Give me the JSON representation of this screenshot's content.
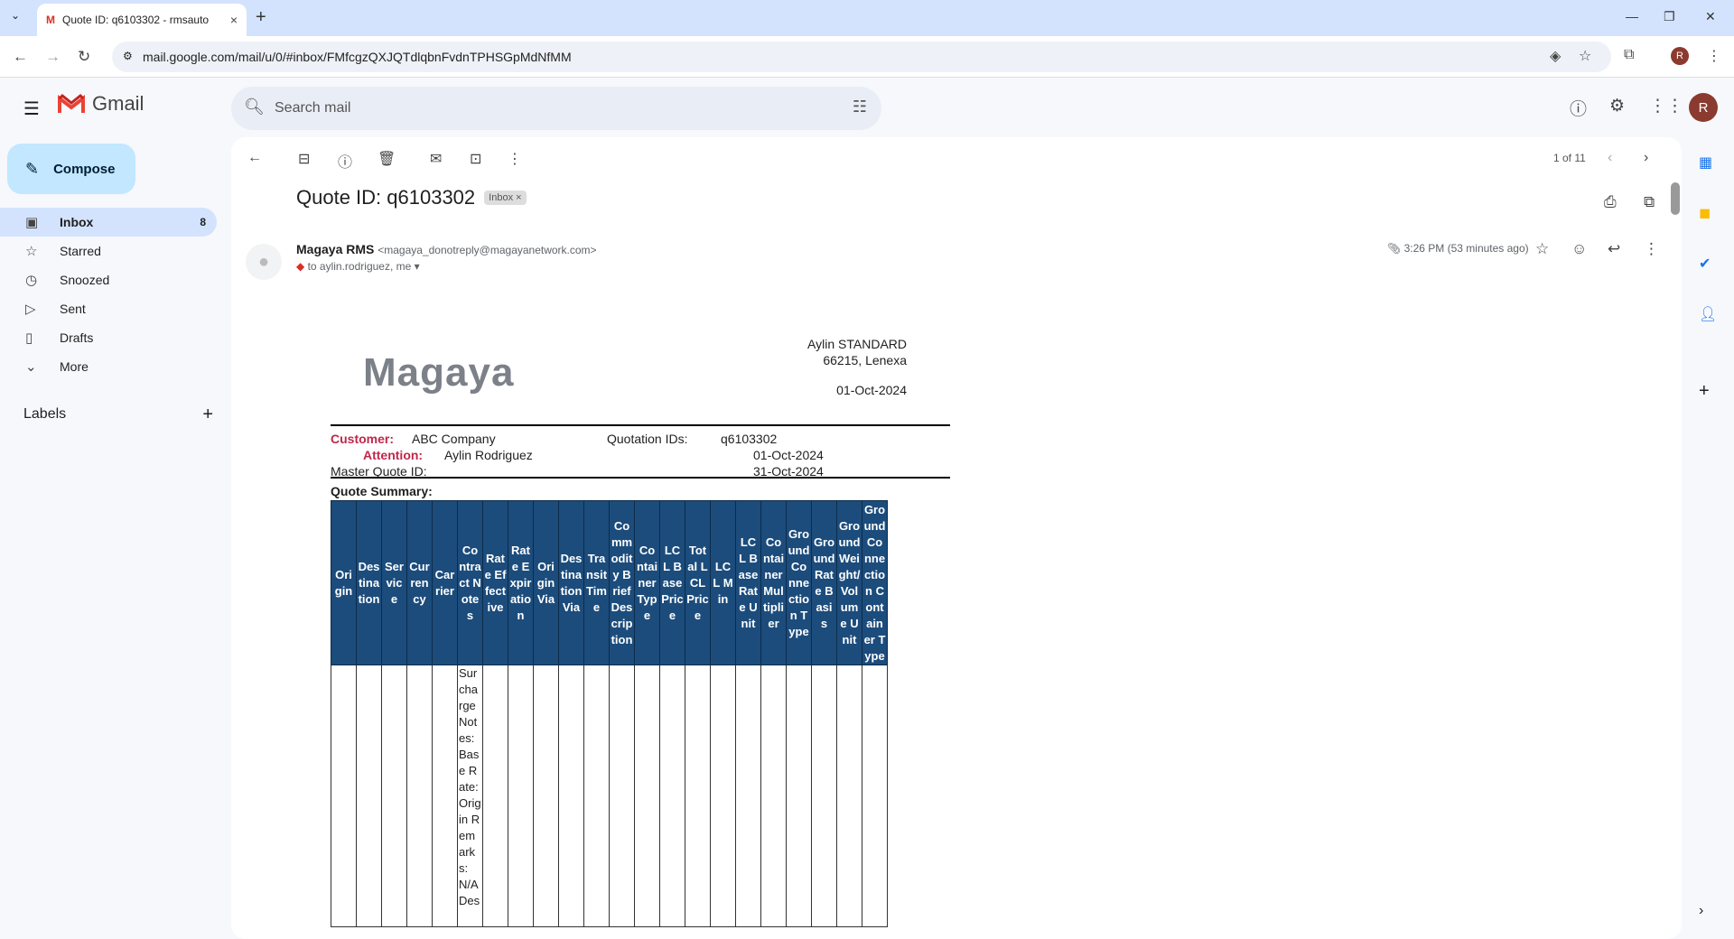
{
  "browser": {
    "tab_title": "Quote ID: q6103302 - rmsauto",
    "url": "mail.google.com/mail/u/0/#inbox/FMfcgzQXJQTdlqbnFvdnTPHSGpMdNfMM",
    "profile_initial": "R"
  },
  "gmail": {
    "logo_text": "Gmail",
    "search_placeholder": "Search mail",
    "avatar_initial": "R",
    "compose_label": "Compose",
    "nav": [
      {
        "label": "Inbox",
        "count": "8",
        "icon": "inbox-icon"
      },
      {
        "label": "Starred",
        "count": "",
        "icon": "star-icon"
      },
      {
        "label": "Snoozed",
        "count": "",
        "icon": "clock-icon"
      },
      {
        "label": "Sent",
        "count": "",
        "icon": "send-icon"
      },
      {
        "label": "Drafts",
        "count": "",
        "icon": "draft-icon"
      },
      {
        "label": "More",
        "count": "",
        "icon": "chevron-down-icon"
      }
    ],
    "labels_heading": "Labels"
  },
  "message": {
    "pager": "1 of 11",
    "subject": "Quote ID: q6103302",
    "chip": "Inbox",
    "sender_name": "Magaya RMS",
    "sender_email": "<magaya_donotreply@magayanetwork.com>",
    "recipients": "to aylin.rodriguez, me",
    "time": "3:26 PM (53 minutes ago)"
  },
  "quote": {
    "logo_text": "Magaya",
    "address_line1": "Aylin STANDARD",
    "address_line2": "66215, Lenexa",
    "date": "01-Oct-2024",
    "customer_label": "Customer:",
    "customer_value": "ABC Company",
    "attention_label": "Attention:",
    "attention_value": "Aylin Rodriguez",
    "master_label": "Master Quote ID:",
    "quotation_ids_label": "Quotation IDs:",
    "quotation_ids_value": "q6103302",
    "date1": "01-Oct-2024",
    "date2": "31-Oct-2024",
    "summary_label": "Quote Summary:",
    "columns": [
      "Origin",
      "Destination",
      "Service",
      "Currency",
      "Carrier",
      "Contract Notes",
      "Rate Effective",
      "Rate Expiration",
      "Origin Via",
      "Destination Via",
      "Transit Time",
      "Commodity Brief Description",
      "Container Type",
      "LCL Base Price",
      "Total LCL Price",
      "LCL Min",
      "LCL Base Rate Unit",
      "Container Multiplier",
      "Ground Connection Type",
      "Ground Rate Basis",
      "Ground Weight/Volume Unit",
      "Ground Connection Container Type"
    ],
    "row": [
      "",
      "",
      "",
      "",
      "",
      "Surcharge Notes: Base Rate: Origin Remarks: N/A Des",
      "",
      "",
      "",
      "",
      "",
      "",
      "",
      "",
      "",
      "",
      "",
      "",
      "",
      "",
      "",
      ""
    ]
  }
}
